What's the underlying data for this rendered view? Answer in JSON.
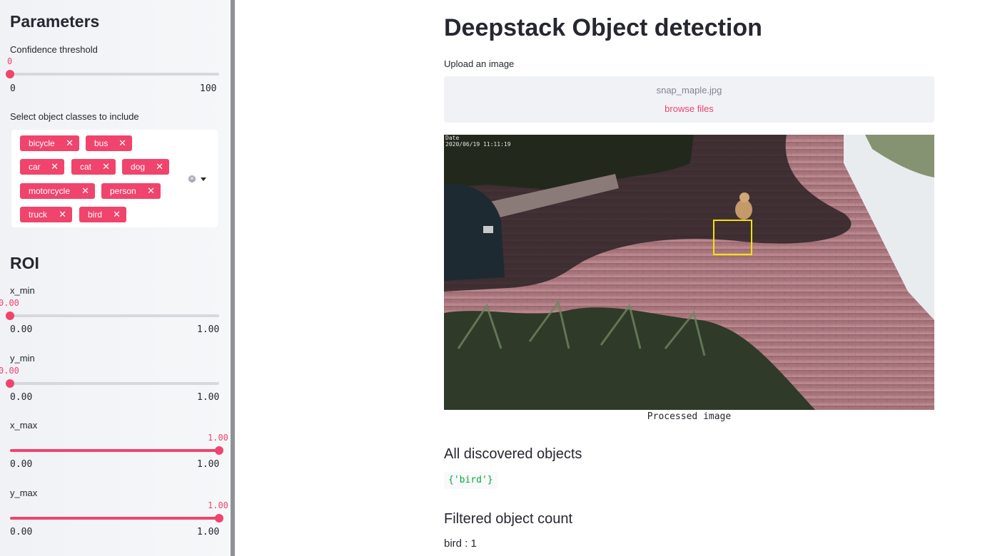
{
  "sidebar": {
    "parameters_heading": "Parameters",
    "confidence": {
      "label": "Confidence threshold",
      "value": "0",
      "min": "0",
      "max": "100",
      "fraction": 0.0
    },
    "classes_label": "Select object classes to include",
    "selected_classes": [
      "bicycle",
      "bus",
      "car",
      "cat",
      "dog",
      "motorcycle",
      "person",
      "truck",
      "bird"
    ],
    "roi_heading": "ROI",
    "roi": [
      {
        "label": "x_min",
        "value": "0.00",
        "min": "0.00",
        "max": "1.00",
        "fraction": 0.0
      },
      {
        "label": "y_min",
        "value": "0.00",
        "min": "0.00",
        "max": "1.00",
        "fraction": 0.0
      },
      {
        "label": "x_max",
        "value": "1.00",
        "min": "0.00",
        "max": "1.00",
        "fraction": 1.0
      },
      {
        "label": "y_max",
        "value": "1.00",
        "min": "0.00",
        "max": "1.00",
        "fraction": 1.0
      }
    ],
    "tag_remove_glyph": "✕",
    "clear_glyph": "✕"
  },
  "main": {
    "title": "Deepstack Object detection",
    "upload_label": "Upload an image",
    "file_name": "snap_maple.jpg",
    "browse_label": "browse files",
    "image_timestamp": "2020/06/19  11:11:19",
    "image_timestamp_label": "Date",
    "image_caption": "Processed image",
    "all_objects_heading": "All discovered objects",
    "all_objects_value": "{'bird'}",
    "filtered_heading": "Filtered object count",
    "filtered_value": "bird : 1"
  },
  "colors": {
    "accent": "#f0446d",
    "sidebar_bg": "#f0f2f6",
    "code_green": "#09ab3b",
    "bbox_yellow": "#f4e200"
  }
}
